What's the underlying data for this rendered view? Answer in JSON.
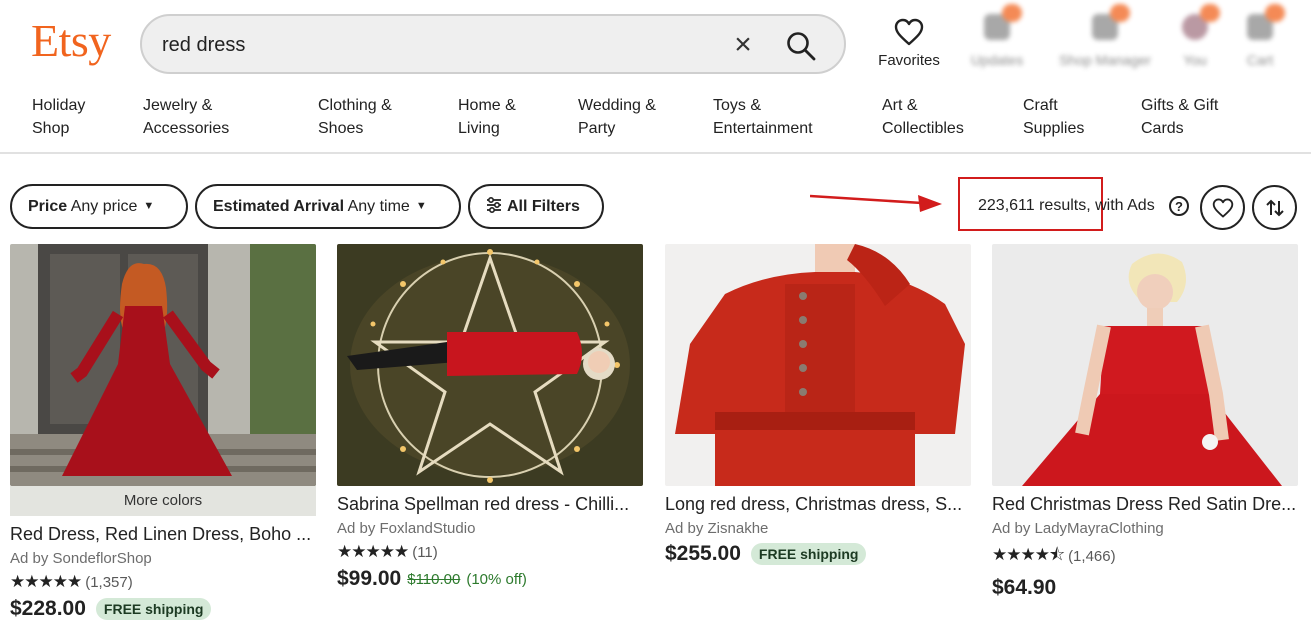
{
  "header": {
    "logo": "Etsy",
    "search_value": "red dress",
    "favorites_label": "Favorites",
    "blurred_nav": [
      "Updates",
      "Shop Manager",
      "You",
      "Cart"
    ]
  },
  "categories": [
    {
      "line1": "Holiday",
      "line2": "Shop"
    },
    {
      "line1": "Jewelry &",
      "line2": "Accessories"
    },
    {
      "line1": "Clothing &",
      "line2": "Shoes"
    },
    {
      "line1": "Home &",
      "line2": "Living"
    },
    {
      "line1": "Wedding &",
      "line2": "Party"
    },
    {
      "line1": "Toys &",
      "line2": "Entertainment"
    },
    {
      "line1": "Art &",
      "line2": "Collectibles"
    },
    {
      "line1": "Craft",
      "line2": "Supplies"
    },
    {
      "line1": "Gifts & Gift",
      "line2": "Cards"
    }
  ],
  "filters": {
    "price_label": "Price",
    "price_value": "Any price",
    "arrival_label": "Estimated Arrival",
    "arrival_value": "Any time",
    "all_filters": "All Filters",
    "results_text": "223,611 results, with Ads",
    "help": "?"
  },
  "listings": [
    {
      "more_colors": "More colors",
      "title": "Red Dress, Red Linen Dress, Boho ...",
      "seller": "Ad by SondeflorShop",
      "stars": "★★★★★",
      "reviews": "(1,357)",
      "price": "$228.00",
      "shipping": "FREE shipping"
    },
    {
      "title": "Sabrina Spellman red dress - Chilli...",
      "seller": "Ad by FoxlandStudio",
      "stars": "★★★★★",
      "reviews": "(11)",
      "price": "$99.00",
      "original_price": "$110.00",
      "discount": "(10% off)"
    },
    {
      "title": "Long red dress, Christmas dress, S...",
      "seller": "Ad by Zisnakhe",
      "price": "$255.00",
      "shipping": "FREE shipping"
    },
    {
      "title": "Red Christmas Dress Red Satin Dre...",
      "seller": "Ad by LadyMayraClothing",
      "stars": "★★★★⯪",
      "reviews": "(1,466)",
      "price": "$64.90"
    }
  ],
  "colors": {
    "brand": "#f1641e",
    "highlight": "#d21c1c",
    "free_badge": "#d4e9d7"
  }
}
